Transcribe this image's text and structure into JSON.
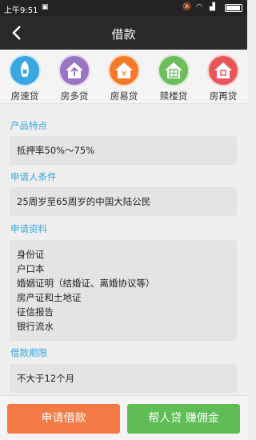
{
  "status_bar": {
    "time": "上午9:51"
  },
  "header": {
    "title": "借款"
  },
  "tabs": [
    {
      "label": "房速贷",
      "color": "#3aa7e0",
      "icon": "house-rocket-icon"
    },
    {
      "label": "房多贷",
      "color": "#9a74c4",
      "icon": "house-arrow-up-icon"
    },
    {
      "label": "房易贷",
      "color": "#f47a2a",
      "icon": "house-yen-icon"
    },
    {
      "label": "赎楼贷",
      "color": "#6cbd5b",
      "icon": "building-icon"
    },
    {
      "label": "房再贷",
      "color": "#e9565a",
      "icon": "house-refresh-icon"
    }
  ],
  "sections": {
    "features": {
      "title": "产品特点",
      "lines": [
        "抵押率50%～75%"
      ]
    },
    "conditions": {
      "title": "申请人条件",
      "lines": [
        "25周岁至65周岁的中国大陆公民"
      ]
    },
    "documents": {
      "title": "申请资料",
      "lines": [
        "身份证",
        "户口本",
        "婚姻证明（结婚证、离婚协议等）",
        "房产证和土地证",
        "征信报告",
        "银行流水"
      ]
    },
    "term": {
      "title": "借款期限",
      "lines": [
        "不大于12个月"
      ]
    }
  },
  "buttons": {
    "apply": "申请借款",
    "help": "帮人贷 赚佣金"
  },
  "colors": {
    "accent": "#3aa7e0",
    "apply_button": "#f47a45",
    "help_button": "#5fbd56"
  }
}
